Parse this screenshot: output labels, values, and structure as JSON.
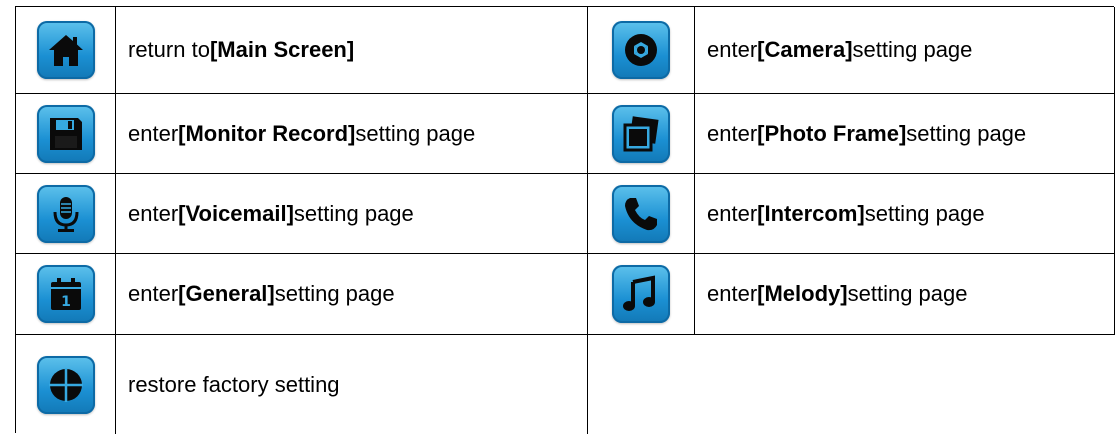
{
  "rows": [
    {
      "left": {
        "icon": "home-icon",
        "prefix": "return to ",
        "bold": "[Main Screen]",
        "suffix": ""
      },
      "right": {
        "icon": "camera-icon",
        "prefix": "enter ",
        "bold": "[Camera]",
        "suffix": " setting page"
      }
    },
    {
      "left": {
        "icon": "floppy-disk-icon",
        "prefix": "enter ",
        "bold": "[Monitor Record]",
        "suffix": " setting page"
      },
      "right": {
        "icon": "photo-frame-icon",
        "prefix": "enter ",
        "bold": "[Photo Frame]",
        "suffix": " setting page"
      }
    },
    {
      "left": {
        "icon": "microphone-icon",
        "prefix": "enter ",
        "bold": "[Voicemail]",
        "suffix": " setting page"
      },
      "right": {
        "icon": "phone-icon",
        "prefix": "enter ",
        "bold": "[Intercom]",
        "suffix": " setting page"
      }
    },
    {
      "left": {
        "icon": "calendar-icon",
        "prefix": "enter ",
        "bold": "[General]",
        "suffix": " setting page"
      },
      "right": {
        "icon": "music-note-icon",
        "prefix": "enter ",
        "bold": "[Melody]",
        "suffix": " setting page"
      }
    },
    {
      "left": {
        "icon": "restore-icon",
        "text": "restore factory setting"
      }
    }
  ],
  "colors": {
    "icon_top": "#5ec2ec",
    "icon_bottom": "#1278b6",
    "border": "#000000"
  }
}
